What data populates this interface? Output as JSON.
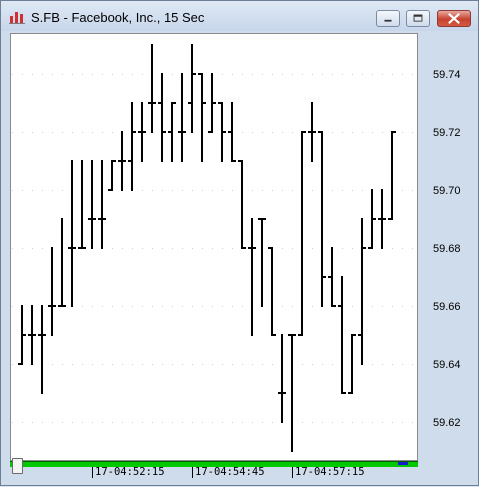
{
  "window": {
    "title": "S.FB - Facebook, Inc., 15 Sec",
    "icon": "bar-chart-app-icon"
  },
  "window_controls": {
    "minimize_icon": "minimize-icon",
    "maximize_icon": "maximize-icon",
    "close_icon": "close-icon"
  },
  "colors": {
    "bars": "#000000",
    "scrollbar": "#00c800",
    "scroll_end": "#1a1acd",
    "background": "#ffffff"
  },
  "chart_data": {
    "type": "ohlc",
    "title": "S.FB - Facebook, Inc., 15 Sec",
    "x_tick_labels": [
      "17-04:52:15",
      "17-04:54:45",
      "17-04:57:15"
    ],
    "y_tick_labels": [
      "59.74",
      "59.72",
      "59.70",
      "59.68",
      "59.66",
      "59.64",
      "59.62"
    ],
    "ylim": [
      59.605,
      59.75
    ],
    "grid": true,
    "bars": [
      {
        "o": 59.64,
        "h": 59.66,
        "l": 59.64,
        "c": 59.65
      },
      {
        "o": 59.65,
        "h": 59.66,
        "l": 59.64,
        "c": 59.65
      },
      {
        "o": 59.65,
        "h": 59.66,
        "l": 59.63,
        "c": 59.65
      },
      {
        "o": 59.66,
        "h": 59.68,
        "l": 59.65,
        "c": 59.66
      },
      {
        "o": 59.66,
        "h": 59.69,
        "l": 59.66,
        "c": 59.66
      },
      {
        "o": 59.68,
        "h": 59.71,
        "l": 59.66,
        "c": 59.68
      },
      {
        "o": 59.68,
        "h": 59.71,
        "l": 59.68,
        "c": 59.68
      },
      {
        "o": 59.69,
        "h": 59.71,
        "l": 59.68,
        "c": 59.69
      },
      {
        "o": 59.69,
        "h": 59.71,
        "l": 59.68,
        "c": 59.69
      },
      {
        "o": 59.7,
        "h": 59.71,
        "l": 59.7,
        "c": 59.71
      },
      {
        "o": 59.71,
        "h": 59.72,
        "l": 59.7,
        "c": 59.71
      },
      {
        "o": 59.71,
        "h": 59.73,
        "l": 59.7,
        "c": 59.72
      },
      {
        "o": 59.72,
        "h": 59.73,
        "l": 59.71,
        "c": 59.72
      },
      {
        "o": 59.73,
        "h": 59.75,
        "l": 59.72,
        "c": 59.73
      },
      {
        "o": 59.73,
        "h": 59.74,
        "l": 59.71,
        "c": 59.72
      },
      {
        "o": 59.72,
        "h": 59.73,
        "l": 59.71,
        "c": 59.73
      },
      {
        "o": 59.72,
        "h": 59.74,
        "l": 59.71,
        "c": 59.72
      },
      {
        "o": 59.73,
        "h": 59.75,
        "l": 59.72,
        "c": 59.74
      },
      {
        "o": 59.74,
        "h": 59.74,
        "l": 59.71,
        "c": 59.73
      },
      {
        "o": 59.72,
        "h": 59.74,
        "l": 59.72,
        "c": 59.73
      },
      {
        "o": 59.73,
        "h": 59.73,
        "l": 59.71,
        "c": 59.72
      },
      {
        "o": 59.72,
        "h": 59.73,
        "l": 59.71,
        "c": 59.71
      },
      {
        "o": 59.71,
        "h": 59.71,
        "l": 59.68,
        "c": 59.68
      },
      {
        "o": 59.68,
        "h": 59.69,
        "l": 59.65,
        "c": 59.68
      },
      {
        "o": 59.69,
        "h": 59.69,
        "l": 59.66,
        "c": 59.69
      },
      {
        "o": 59.68,
        "h": 59.68,
        "l": 59.65,
        "c": 59.65
      },
      {
        "o": 59.63,
        "h": 59.65,
        "l": 59.62,
        "c": 59.63
      },
      {
        "o": 59.65,
        "h": 59.65,
        "l": 59.61,
        "c": 59.65
      },
      {
        "o": 59.65,
        "h": 59.72,
        "l": 59.65,
        "c": 59.72
      },
      {
        "o": 59.72,
        "h": 59.73,
        "l": 59.71,
        "c": 59.72
      },
      {
        "o": 59.72,
        "h": 59.72,
        "l": 59.66,
        "c": 59.67
      },
      {
        "o": 59.67,
        "h": 59.68,
        "l": 59.66,
        "c": 59.66
      },
      {
        "o": 59.66,
        "h": 59.67,
        "l": 59.63,
        "c": 59.63
      },
      {
        "o": 59.63,
        "h": 59.65,
        "l": 59.63,
        "c": 59.65
      },
      {
        "o": 59.65,
        "h": 59.69,
        "l": 59.64,
        "c": 59.68
      },
      {
        "o": 59.68,
        "h": 59.7,
        "l": 59.68,
        "c": 59.69
      },
      {
        "o": 59.69,
        "h": 59.7,
        "l": 59.68,
        "c": 59.69
      },
      {
        "o": 59.69,
        "h": 59.72,
        "l": 59.69,
        "c": 59.72
      }
    ]
  }
}
